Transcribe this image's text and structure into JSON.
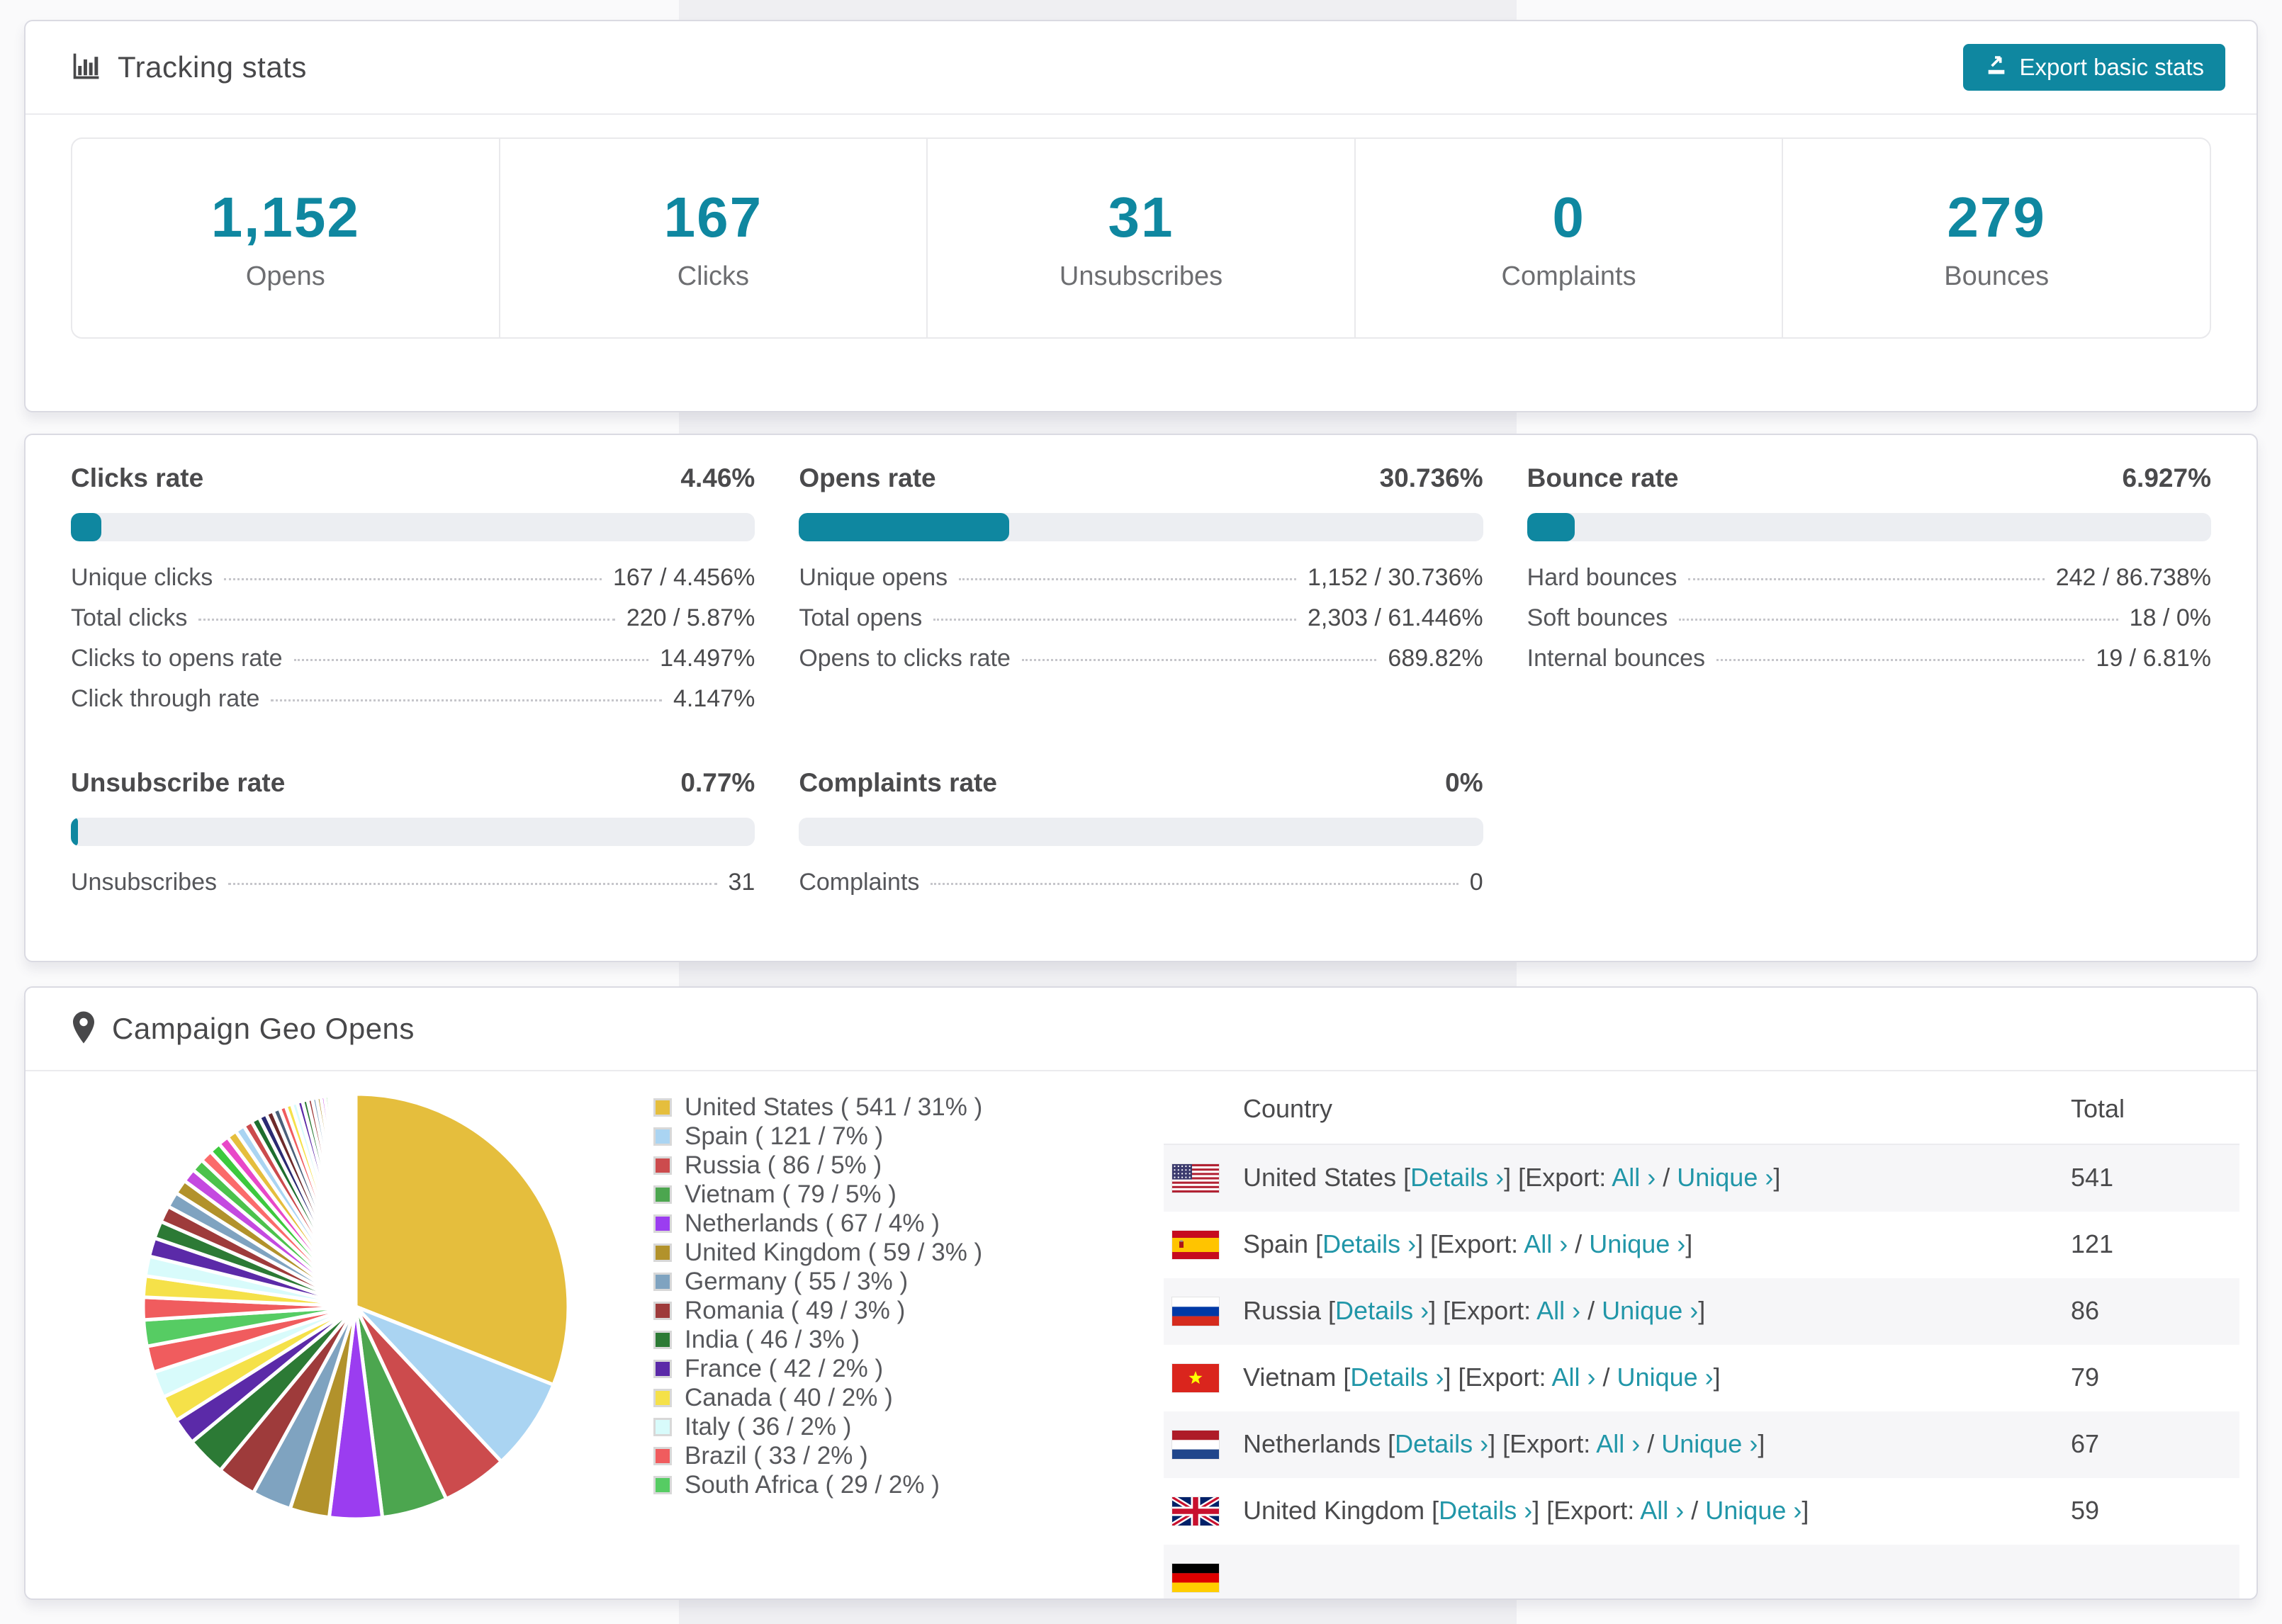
{
  "accent": "#0f87a0",
  "link_color": "#2196a8",
  "tracking": {
    "title": "Tracking stats",
    "export_label": "Export basic stats",
    "stats": [
      {
        "value": "1,152",
        "label": "Opens"
      },
      {
        "value": "167",
        "label": "Clicks"
      },
      {
        "value": "31",
        "label": "Unsubscribes"
      },
      {
        "value": "0",
        "label": "Complaints"
      },
      {
        "value": "279",
        "label": "Bounces"
      }
    ]
  },
  "rates": {
    "panels": [
      {
        "title": "Clicks rate",
        "value": "4.46%",
        "percent": 4.46,
        "rows": [
          {
            "label": "Unique clicks",
            "value": "167 / 4.456%"
          },
          {
            "label": "Total clicks",
            "value": "220 / 5.87%"
          },
          {
            "label": "Clicks to opens rate",
            "value": "14.497%"
          },
          {
            "label": "Click through rate",
            "value": "4.147%"
          }
        ]
      },
      {
        "title": "Opens rate",
        "value": "30.736%",
        "percent": 30.736,
        "rows": [
          {
            "label": "Unique opens",
            "value": "1,152 / 30.736%"
          },
          {
            "label": "Total opens",
            "value": "2,303 / 61.446%"
          },
          {
            "label": "Opens to clicks rate",
            "value": "689.82%"
          }
        ]
      },
      {
        "title": "Bounce rate",
        "value": "6.927%",
        "percent": 6.927,
        "rows": [
          {
            "label": "Hard bounces",
            "value": "242 / 86.738%"
          },
          {
            "label": "Soft bounces",
            "value": "18 / 0%"
          },
          {
            "label": "Internal bounces",
            "value": "19 / 6.81%"
          }
        ]
      },
      {
        "title": "Unsubscribe rate",
        "value": "0.77%",
        "percent": 0.77,
        "rows": [
          {
            "label": "Unsubscribes",
            "value": "31"
          }
        ]
      },
      {
        "title": "Complaints rate",
        "value": "0%",
        "percent": 0,
        "rows": [
          {
            "label": "Complaints",
            "value": "0"
          }
        ]
      }
    ]
  },
  "geo": {
    "title": "Campaign Geo Opens",
    "chart_data": {
      "type": "pie",
      "title": "Campaign Geo Opens",
      "legend_position": "right",
      "slices": [
        {
          "name": "United States",
          "count": 541,
          "pct": 31,
          "color": "#e5be3d"
        },
        {
          "name": "Spain",
          "count": 121,
          "pct": 7,
          "color": "#aad4f2"
        },
        {
          "name": "Russia",
          "count": 86,
          "pct": 5,
          "color": "#cc4b4d"
        },
        {
          "name": "Vietnam",
          "count": 79,
          "pct": 5,
          "color": "#4ca64f"
        },
        {
          "name": "Netherlands",
          "count": 67,
          "pct": 4,
          "color": "#9b3df0"
        },
        {
          "name": "United Kingdom",
          "count": 59,
          "pct": 3,
          "color": "#b2922b"
        },
        {
          "name": "Germany",
          "count": 55,
          "pct": 3,
          "color": "#7fa3c0"
        },
        {
          "name": "Romania",
          "count": 49,
          "pct": 3,
          "color": "#9e3b3b"
        },
        {
          "name": "India",
          "count": 46,
          "pct": 3,
          "color": "#2c7a35"
        },
        {
          "name": "France",
          "count": 42,
          "pct": 2,
          "color": "#5b2aa8"
        },
        {
          "name": "Canada",
          "count": 40,
          "pct": 2,
          "color": "#f5e149"
        },
        {
          "name": "Italy",
          "count": 36,
          "pct": 2,
          "color": "#d8fbfb"
        },
        {
          "name": "Brazil",
          "count": 33,
          "pct": 2,
          "color": "#f05c5e"
        },
        {
          "name": "South Africa",
          "count": 29,
          "pct": 2,
          "color": "#56cc63"
        }
      ],
      "other_pct": 26
    },
    "table": {
      "headers": [
        "Country",
        "Total"
      ],
      "details_label": "Details ›",
      "export_prefix": "Export:",
      "all_label": "All ›",
      "unique_label": "Unique ›",
      "rows": [
        {
          "country": "United States",
          "total": "541",
          "flag": "us"
        },
        {
          "country": "Spain",
          "total": "121",
          "flag": "es"
        },
        {
          "country": "Russia",
          "total": "86",
          "flag": "ru"
        },
        {
          "country": "Vietnam",
          "total": "79",
          "flag": "vn"
        },
        {
          "country": "Netherlands",
          "total": "67",
          "flag": "nl"
        },
        {
          "country": "United Kingdom",
          "total": "59",
          "flag": "gb"
        },
        {
          "country": "",
          "total": "",
          "flag": "de"
        }
      ]
    }
  }
}
